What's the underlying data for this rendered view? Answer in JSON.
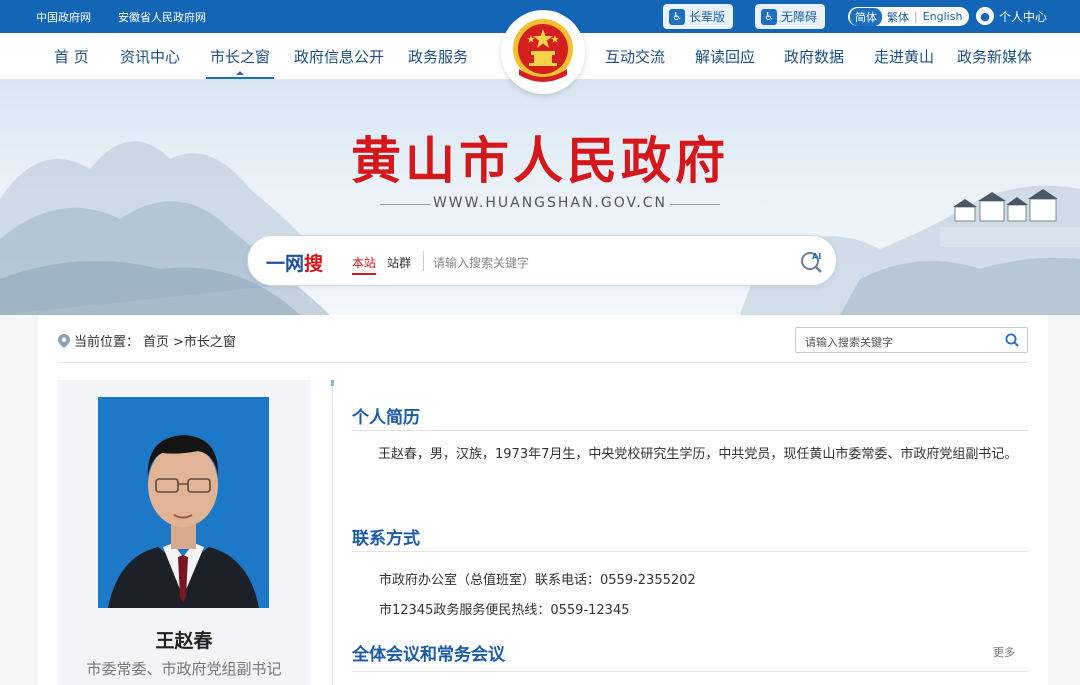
{
  "topbar": {
    "links": [
      "中国政府网",
      "安徽省人民政府网"
    ],
    "elder_label": "长辈版",
    "access_label": "无障碍",
    "lang": [
      "简体",
      "繁体",
      "English"
    ],
    "user_center": "个人中心"
  },
  "nav": {
    "left": [
      "首 页",
      "资讯中心",
      "市长之窗",
      "政府信息公开",
      "政务服务"
    ],
    "right": [
      "互动交流",
      "解读回应",
      "政府数据",
      "走进黄山",
      "政务新媒体"
    ],
    "active": "市长之窗"
  },
  "banner": {
    "title": "黄山市人民政府",
    "url": "WWW.HUANGSHAN.GOV.CN"
  },
  "search": {
    "brand_a": "一网",
    "brand_b": "搜",
    "scope_on": "本站",
    "scope_off": "站群",
    "placeholder": "请输入搜索关键字"
  },
  "breadcrumb": {
    "prefix": "当前位置：",
    "home": "首页",
    "current": ">市长之窗"
  },
  "mini_search": {
    "placeholder": "请输入搜索关键字"
  },
  "profile": {
    "name": "王赵春",
    "title": "市委常委、市政府党组副书记"
  },
  "sections": {
    "bio_heading": "个人简历",
    "bio_text": "王赵春，男，汉族，1973年7月生，中央党校研究生学历，中共党员，现任黄山市委常委、市政府党组副书记。",
    "contact_heading": "联系方式",
    "contact_lines": [
      "市政府办公室（总值班室）联系电话：0559-2355202",
      "市12345政务服务便民热线：0559-12345"
    ],
    "meetings_heading": "全体会议和常务会议",
    "more_label": "更多"
  },
  "colors": {
    "primary": "#1366b6",
    "title_red": "#d3171b",
    "heading_blue": "#1c5ba8"
  }
}
